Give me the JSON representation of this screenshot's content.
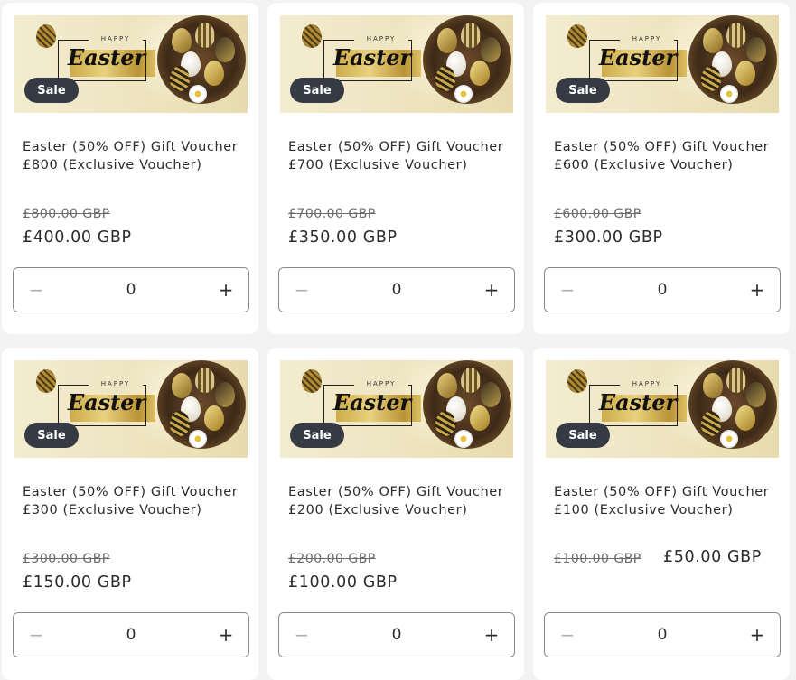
{
  "products": [
    {
      "badge": "Sale",
      "title": "Easter (50% OFF) Gift Voucher £800 (Exclusive Voucher)",
      "compare_price": "£800.00 GBP",
      "price": "£400.00 GBP",
      "quantity": "0",
      "banner": {
        "happy": "HAPPY",
        "script": "Easter"
      }
    },
    {
      "badge": "Sale",
      "title": "Easter (50% OFF) Gift Voucher £700 (Exclusive Voucher)",
      "compare_price": "£700.00 GBP",
      "price": "£350.00 GBP",
      "quantity": "0",
      "banner": {
        "happy": "HAPPY",
        "script": "Easter"
      }
    },
    {
      "badge": "Sale",
      "title": "Easter (50% OFF) Gift Voucher £600 (Exclusive Voucher)",
      "compare_price": "£600.00 GBP",
      "price": "£300.00 GBP",
      "quantity": "0",
      "banner": {
        "happy": "HAPPY",
        "script": "Easter"
      }
    },
    {
      "badge": "Sale",
      "title": "Easter (50% OFF) Gift Voucher £300 (Exclusive Voucher)",
      "compare_price": "£300.00 GBP",
      "price": "£150.00 GBP",
      "quantity": "0",
      "banner": {
        "happy": "HAPPY",
        "script": "Easter"
      }
    },
    {
      "badge": "Sale",
      "title": "Easter (50% OFF) Gift Voucher £200 (Exclusive Voucher)",
      "compare_price": "£200.00 GBP",
      "price": "£100.00 GBP",
      "quantity": "0",
      "banner": {
        "happy": "HAPPY",
        "script": "Easter"
      }
    },
    {
      "badge": "Sale",
      "title": "Easter (50% OFF) Gift Voucher £100 (Exclusive Voucher)",
      "compare_price": "£100.00 GBP",
      "price": "£50.00 GBP",
      "quantity": "0",
      "banner": {
        "happy": "HAPPY",
        "script": "Easter"
      }
    }
  ],
  "quantity_controls": {
    "decrease": "−",
    "increase": "+"
  },
  "colors": {
    "badge_bg": "#363a44",
    "page_bg": "#f3f3f3",
    "card_bg": "#ffffff",
    "text": "#2b2b2b"
  }
}
